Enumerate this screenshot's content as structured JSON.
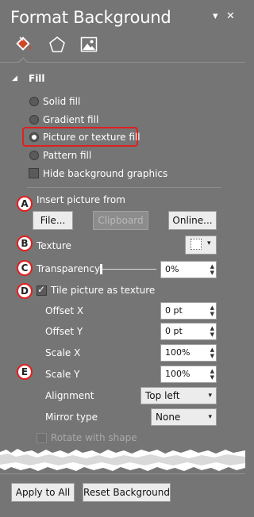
{
  "header": {
    "title": "Format Background",
    "dropdown_icon": "chevron-down-icon",
    "close_icon": "close-icon",
    "dropdown_glyph": "▾",
    "close_glyph": "✕"
  },
  "tabs": [
    {
      "icon": "paint-bucket-icon",
      "selected": true
    },
    {
      "icon": "pentagon-icon",
      "selected": false
    },
    {
      "icon": "picture-icon",
      "selected": false
    }
  ],
  "fill_section": {
    "label": "Fill",
    "expanded_glyph": "◢",
    "options": [
      {
        "label": "Solid fill",
        "selected": false
      },
      {
        "label": "Gradient fill",
        "selected": false
      },
      {
        "label": "Picture or texture fill",
        "selected": true
      },
      {
        "label": "Pattern fill",
        "selected": false
      }
    ],
    "hide_background_graphics": {
      "label": "Hide background graphics",
      "checked": false
    }
  },
  "insert_picture": {
    "label": "Insert picture from",
    "buttons": [
      {
        "label": "File...",
        "enabled": true
      },
      {
        "label": "Clipboard",
        "enabled": false
      },
      {
        "label": "Online...",
        "enabled": true
      }
    ]
  },
  "texture": {
    "label": "Texture",
    "chevron": "▾"
  },
  "transparency": {
    "label": "Transparency",
    "value": "0%",
    "level": 0
  },
  "tile": {
    "label": "Tile picture as texture",
    "checked": true,
    "fields": [
      {
        "label": "Offset X",
        "value": "0 pt"
      },
      {
        "label": "Offset Y",
        "value": "0 pt"
      },
      {
        "label": "Scale X",
        "value": "100%"
      },
      {
        "label": "Scale Y",
        "value": "100%"
      }
    ],
    "alignment": {
      "label": "Alignment",
      "value": "Top left"
    },
    "mirror_type": {
      "label": "Mirror type",
      "value": "None"
    }
  },
  "rotate_with_shape": {
    "label": "Rotate with shape",
    "checked": false,
    "enabled": false
  },
  "annotations": [
    "A",
    "B",
    "C",
    "D",
    "E"
  ],
  "footer": {
    "apply_to_all": "Apply to All",
    "reset_background": "Reset Background"
  },
  "spin_arrows": {
    "up": "▲",
    "down": "▼"
  },
  "colors": {
    "panel_bg": "#757575",
    "highlight": "#e02020",
    "button_bg": "#ececec",
    "accent_icon": "#d24726"
  }
}
